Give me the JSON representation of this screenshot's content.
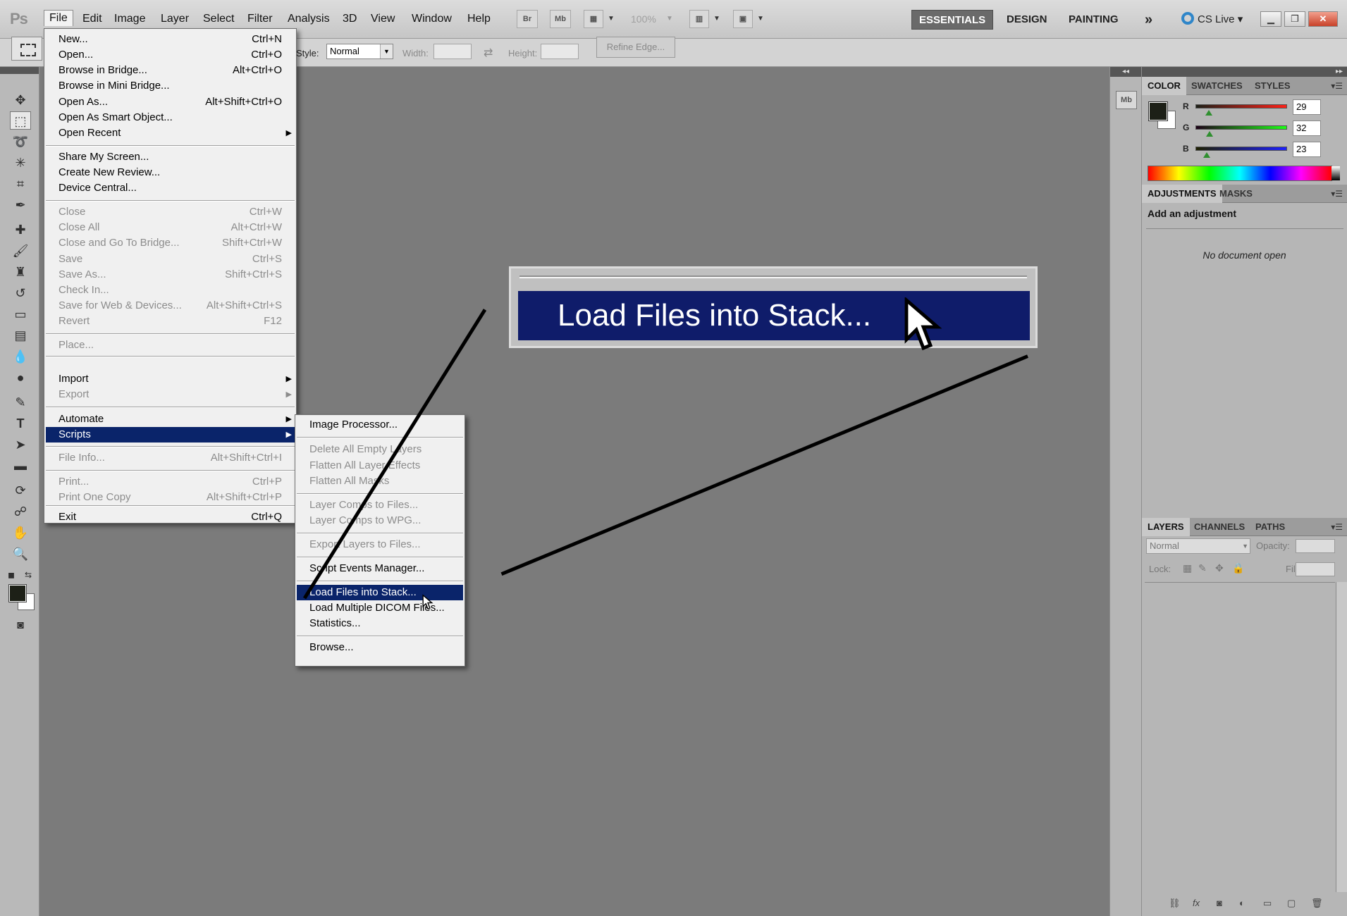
{
  "app": {
    "logo": "Ps"
  },
  "menubar": {
    "items": [
      "File",
      "Edit",
      "Image",
      "Layer",
      "Select",
      "Filter",
      "Analysis",
      "3D",
      "View",
      "Window",
      "Help"
    ],
    "bridge_icon": "Br",
    "minibridge_icon": "Mb",
    "zoom": "100%",
    "workspaces": [
      "ESSENTIALS",
      "DESIGN",
      "PAINTING"
    ],
    "more": "»",
    "cslive": "CS Live"
  },
  "options": {
    "style_label": "Style:",
    "style_value": "Normal",
    "width_label": "Width:",
    "height_label": "Height:",
    "refine_edge": "Refine Edge..."
  },
  "file_menu": {
    "items": [
      {
        "label": "New...",
        "shortcut": "Ctrl+N",
        "disabled": false
      },
      {
        "label": "Open...",
        "shortcut": "Ctrl+O",
        "disabled": false
      },
      {
        "label": "Browse in Bridge...",
        "shortcut": "Alt+Ctrl+O",
        "disabled": false
      },
      {
        "label": "Browse in Mini Bridge...",
        "shortcut": "",
        "disabled": false
      },
      {
        "label": "Open As...",
        "shortcut": "Alt+Shift+Ctrl+O",
        "disabled": false
      },
      {
        "label": "Open As Smart Object...",
        "shortcut": "",
        "disabled": false
      },
      {
        "label": "Open Recent",
        "shortcut": "",
        "disabled": false,
        "submenu": true
      },
      {
        "label": "Share My Screen...",
        "shortcut": "",
        "disabled": false
      },
      {
        "label": "Create New Review...",
        "shortcut": "",
        "disabled": false
      },
      {
        "label": "Device Central...",
        "shortcut": "",
        "disabled": false
      },
      {
        "label": "Close",
        "shortcut": "Ctrl+W",
        "disabled": true
      },
      {
        "label": "Close All",
        "shortcut": "Alt+Ctrl+W",
        "disabled": true
      },
      {
        "label": "Close and Go To Bridge...",
        "shortcut": "Shift+Ctrl+W",
        "disabled": true
      },
      {
        "label": "Save",
        "shortcut": "Ctrl+S",
        "disabled": true
      },
      {
        "label": "Save As...",
        "shortcut": "Shift+Ctrl+S",
        "disabled": true
      },
      {
        "label": "Check In...",
        "shortcut": "",
        "disabled": true
      },
      {
        "label": "Save for Web & Devices...",
        "shortcut": "Alt+Shift+Ctrl+S",
        "disabled": true
      },
      {
        "label": "Revert",
        "shortcut": "F12",
        "disabled": true
      },
      {
        "label": "Place...",
        "shortcut": "",
        "disabled": true
      },
      {
        "label": "Import",
        "shortcut": "",
        "disabled": false,
        "submenu": true
      },
      {
        "label": "Export",
        "shortcut": "",
        "disabled": true,
        "submenu": true
      },
      {
        "label": "Automate",
        "shortcut": "",
        "disabled": false,
        "submenu": true
      },
      {
        "label": "Scripts",
        "shortcut": "",
        "disabled": false,
        "submenu": true,
        "highlight": true
      },
      {
        "label": "File Info...",
        "shortcut": "Alt+Shift+Ctrl+I",
        "disabled": true
      },
      {
        "label": "Print...",
        "shortcut": "Ctrl+P",
        "disabled": true
      },
      {
        "label": "Print One Copy",
        "shortcut": "Alt+Shift+Ctrl+P",
        "disabled": true
      },
      {
        "label": "Exit",
        "shortcut": "Ctrl+Q",
        "disabled": false
      }
    ]
  },
  "scripts_menu": {
    "items": [
      {
        "label": "Image Processor...",
        "disabled": false
      },
      {
        "label": "Delete All Empty Layers",
        "disabled": true
      },
      {
        "label": "Flatten All Layer Effects",
        "disabled": true
      },
      {
        "label": "Flatten All Masks",
        "disabled": true
      },
      {
        "label": "Layer Comps to Files...",
        "disabled": true
      },
      {
        "label": "Layer Comps to WPG...",
        "disabled": true
      },
      {
        "label": "Export Layers to Files...",
        "disabled": true
      },
      {
        "label": "Script Events Manager...",
        "disabled": false
      },
      {
        "label": "Load Files into Stack...",
        "disabled": false,
        "highlight": true
      },
      {
        "label": "Load Multiple DICOM Files...",
        "disabled": false
      },
      {
        "label": "Statistics...",
        "disabled": false
      },
      {
        "label": "Browse...",
        "disabled": false
      }
    ]
  },
  "callout": {
    "label": "Load Files into Stack..."
  },
  "color_panel": {
    "tabs": [
      "COLOR",
      "SWATCHES",
      "STYLES"
    ],
    "r_label": "R",
    "g_label": "G",
    "b_label": "B",
    "r": 29,
    "g": 32,
    "b": 23,
    "fg_color": "#1d2017"
  },
  "adjustments_panel": {
    "tabs": [
      "ADJUSTMENTS",
      "MASKS"
    ],
    "title": "Add an adjustment",
    "message": "No document open"
  },
  "layers_panel": {
    "tabs": [
      "LAYERS",
      "CHANNELS",
      "PATHS"
    ],
    "blend_mode": "Normal",
    "opacity_label": "Opacity:",
    "lock_label": "Lock:",
    "fill_label": "Fill:"
  },
  "colors": {
    "menu_highlight": "#0a246a",
    "callout_bar": "#0f1c6a",
    "canvas": "#7b7b7b"
  }
}
